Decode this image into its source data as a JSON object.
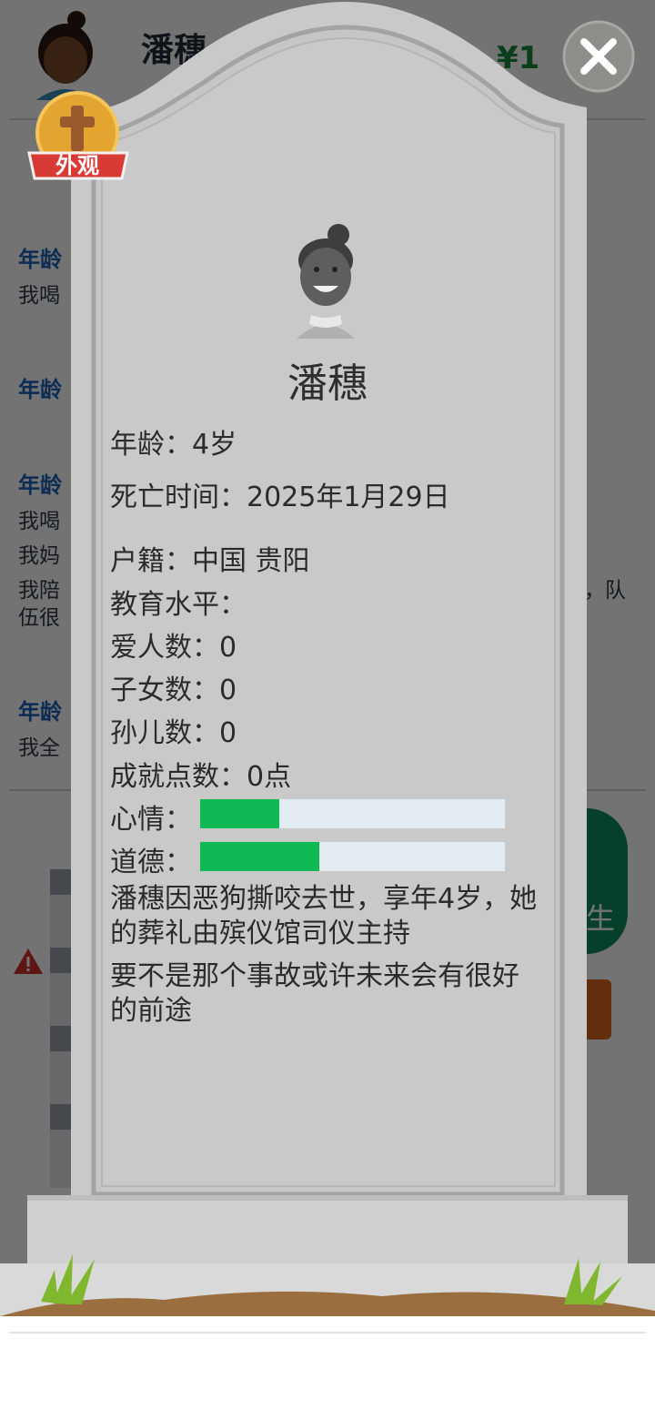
{
  "background": {
    "name": "潘穗",
    "money": "¥1",
    "log_ages": [
      "年龄",
      "年龄",
      "年龄",
      "年龄"
    ],
    "log_lines": [
      "我喝",
      "我喝",
      "我妈",
      "我陪",
      "伍很",
      "我全"
    ],
    "log_tail": "，队",
    "side_button": "生"
  },
  "badge": {
    "label": "外观",
    "icon": "cross-icon"
  },
  "close": {
    "icon": "close-icon"
  },
  "tombstone": {
    "name": "潘穗",
    "fields": [
      {
        "label": "年龄：",
        "value": "4岁"
      },
      {
        "label": "死亡时间：",
        "value": "2025年1月29日"
      },
      {
        "label": "户籍：",
        "value": "中国 贵阳"
      },
      {
        "label": "教育水平：",
        "value": ""
      },
      {
        "label": "爱人数：",
        "value": "0"
      },
      {
        "label": "子女数：",
        "value": "0"
      },
      {
        "label": "孙儿数：",
        "value": "0"
      },
      {
        "label": "成就点数：",
        "value": "0点"
      }
    ],
    "bars": [
      {
        "label": "心情：",
        "fraction": 0.26
      },
      {
        "label": "道德：",
        "fraction": 0.39
      }
    ],
    "epitaph": [
      "潘穗因恶狗撕咬去世，享年4岁，她的葬礼由殡仪馆司仪主持",
      "要不是那个事故或许未来会有很好的前途"
    ]
  },
  "colors": {
    "stone": "#c9c9c9",
    "bar_fill": "#0fba55",
    "bar_track": "#e3ebf3",
    "badge_gold": "#e3a52f",
    "badge_ribbon": "#d83b35"
  }
}
